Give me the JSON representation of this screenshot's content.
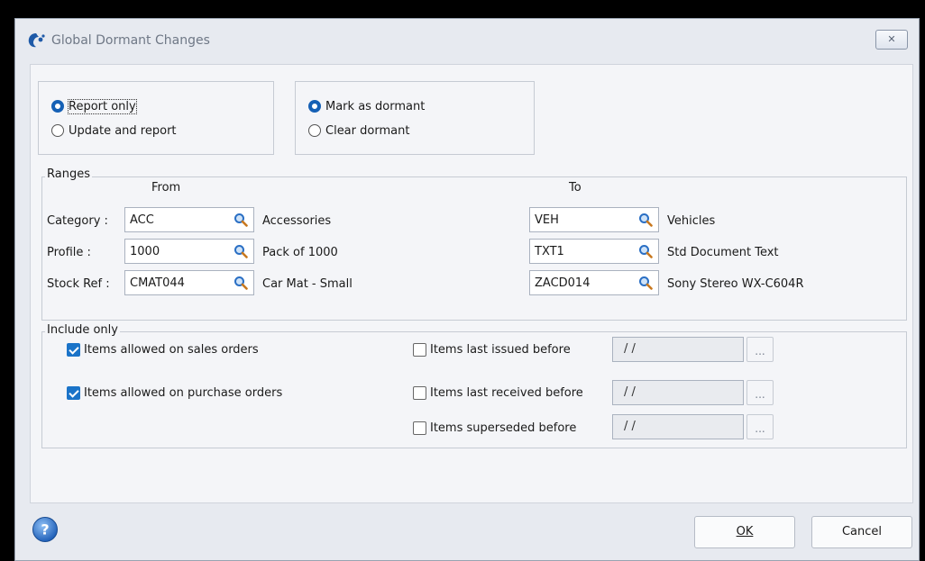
{
  "window": {
    "title": "Global Dormant Changes",
    "close_glyph": "✕"
  },
  "mode": {
    "report_only": {
      "label": "Report only",
      "checked": true
    },
    "update_and_report": {
      "label": "Update and report",
      "checked": false
    }
  },
  "dormant": {
    "mark": {
      "label": "Mark as dormant",
      "checked": true
    },
    "clear": {
      "label": "Clear dormant",
      "checked": false
    }
  },
  "ranges": {
    "title": "Ranges",
    "from_header": "From",
    "to_header": "To",
    "rows": [
      {
        "label": "Category :",
        "from_value": "ACC",
        "from_desc": "Accessories",
        "to_value": "VEH",
        "to_desc": "Vehicles"
      },
      {
        "label": "Profile :",
        "from_value": "1000",
        "from_desc": "Pack of 1000",
        "to_value": "TXT1",
        "to_desc": "Std Document Text"
      },
      {
        "label": "Stock Ref :",
        "from_value": "CMAT044",
        "from_desc": "Car Mat - Small",
        "to_value": "ZACD014",
        "to_desc": "Sony Stereo WX-C604R"
      }
    ]
  },
  "include": {
    "title": "Include only",
    "sales": {
      "label": "Items allowed on sales orders",
      "checked": true
    },
    "purchase": {
      "label": "Items allowed on purchase orders",
      "checked": true
    },
    "issued": {
      "label": "Items last issued before",
      "checked": false,
      "date": "/ /"
    },
    "received": {
      "label": "Items last received before",
      "checked": false,
      "date": "/ /"
    },
    "superseded": {
      "label": "Items superseded before",
      "checked": false,
      "date": "/ /"
    },
    "ellipsis": "..."
  },
  "buttons": {
    "ok": "OK",
    "cancel": "Cancel"
  },
  "icons": {
    "lookup": "magnifier-icon",
    "help": "help-icon",
    "app": "app-logo-icon"
  },
  "colors": {
    "accent": "#1a73c8",
    "radio": "#1560b5"
  }
}
